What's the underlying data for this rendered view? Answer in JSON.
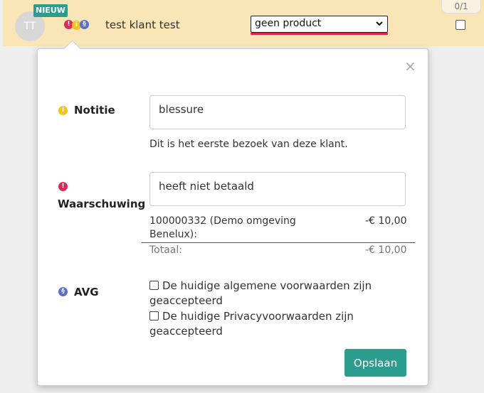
{
  "row": {
    "avatar_initials": "TT",
    "new_badge": "NIEUW",
    "client_name": "test klant test",
    "product_select": {
      "selected": "geen product"
    },
    "counter": "0/1"
  },
  "icons": {
    "warning_glyph": "!",
    "note_glyph": "i",
    "gdpr_glyph": "§"
  },
  "popup": {
    "close_glyph": "×",
    "note": {
      "label": "Notitie",
      "value": "blessure",
      "info": "Dit is het eerste bezoek van deze klant."
    },
    "warning": {
      "label": "Waarschuwing",
      "value": "heeft niet betaald",
      "ledger": {
        "entry_line1": "100000332 (Demo omgeving",
        "entry_line2": "Benelux):",
        "entry_amount": "-€ 10,00",
        "total_label": "Totaal:",
        "total_amount": "-€ 10,00"
      }
    },
    "gdpr": {
      "label": "AVG",
      "checks": [
        {
          "line1": "De huidige algemene voorwaarden zijn",
          "line2": "geaccepteerd"
        },
        {
          "line1": "De huidige Privacyvoorwaarden zijn",
          "line2": "geaccepteerd"
        }
      ]
    },
    "save_label": "Opslaan"
  },
  "colors": {
    "row_bg": "#f9e5b6",
    "accent": "#2a9d8f",
    "warning_red": "#d62f57",
    "note_yellow": "#f4c419",
    "gdpr_blue": "#5a6ecb"
  }
}
